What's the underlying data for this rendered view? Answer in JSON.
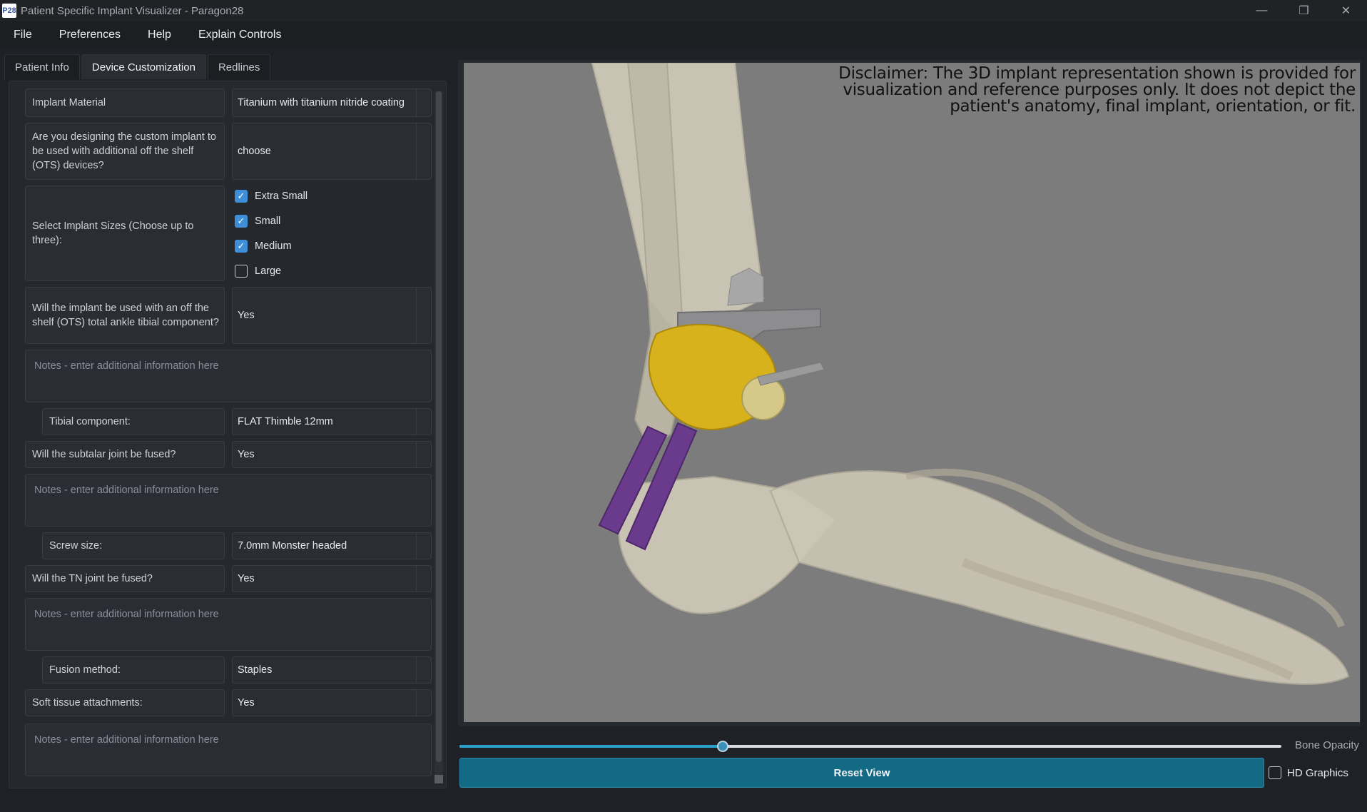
{
  "window": {
    "title": "Patient Specific Implant Visualizer - Paragon28",
    "icon_text": "P28",
    "controls": [
      "—",
      "❐",
      "✕"
    ]
  },
  "menu": [
    "File",
    "Preferences",
    "Help",
    "Explain Controls"
  ],
  "tabs": [
    {
      "label": "Patient Info",
      "active": false
    },
    {
      "label": "Device Customization",
      "active": true
    },
    {
      "label": "Redlines",
      "active": false
    }
  ],
  "form": {
    "implant_material_label": "Implant Material",
    "implant_material_value": "Titanium with titanium nitride coating",
    "ots_question": "Are you designing the custom implant to be used with additional off the shelf (OTS) devices?",
    "ots_value": "choose",
    "sizes_label": "Select Implant Sizes (Choose up to three):",
    "sizes": [
      {
        "label": "Extra Small",
        "checked": true
      },
      {
        "label": "Small",
        "checked": true
      },
      {
        "label": "Medium",
        "checked": true
      },
      {
        "label": "Large",
        "checked": false
      }
    ],
    "tibial_question": "Will the implant be used with an off the shelf (OTS) total ankle tibial component?",
    "tibial_value": "Yes",
    "notes_placeholder": "Notes - enter additional information here",
    "tibial_component_label": "Tibial component:",
    "tibial_component_value": "FLAT Thimble 12mm",
    "subtalar_label": "Will the subtalar joint be fused?",
    "subtalar_value": "Yes",
    "screw_label": "Screw size:",
    "screw_value": "7.0mm Monster headed",
    "tn_label": "Will the TN joint be fused?",
    "tn_value": "Yes",
    "fusion_label": "Fusion method:",
    "fusion_value": "Staples",
    "soft_tissue_label": "Soft tissue attachments:",
    "soft_tissue_value": "Yes"
  },
  "viewport": {
    "disclaimer": "Disclaimer: The 3D implant representation shown is provided for visualization and reference purposes only. It does not depict the patient's anatomy, final implant, orientation, or fit."
  },
  "controls": {
    "bone_opacity_label": "Bone Opacity",
    "bone_opacity_value": 0.32,
    "reset_label": "Reset View",
    "hd_label": "HD Graphics",
    "hd_checked": false
  },
  "colors": {
    "accent": "#3f8fd8",
    "reset_button": "#136a84",
    "slider_fill": "#2aa0c8",
    "implant": "#d8b21c",
    "screws": "#6a3a8c",
    "bone": "#cdc7b6"
  }
}
